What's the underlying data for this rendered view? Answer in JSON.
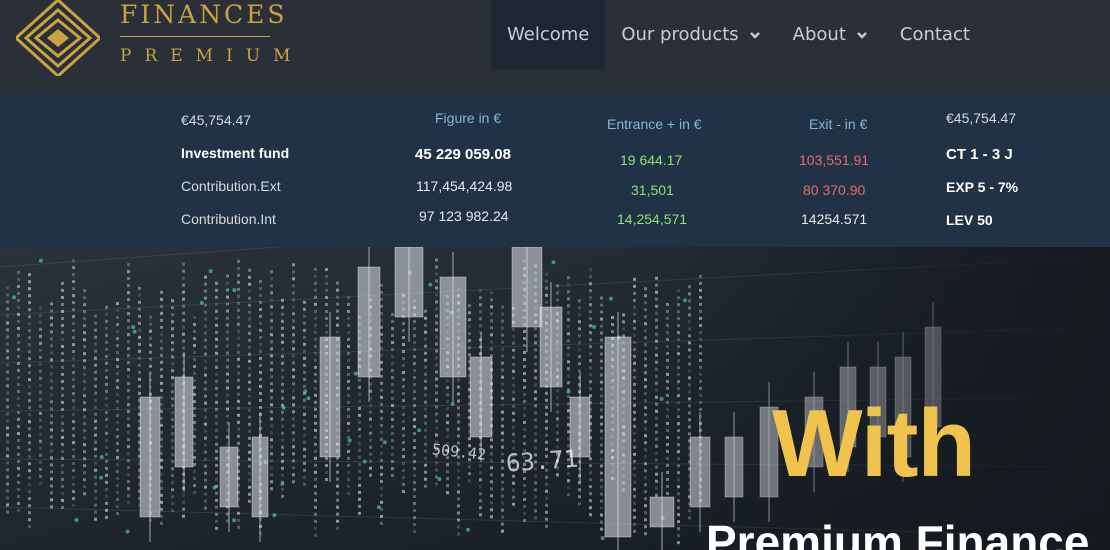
{
  "logo": {
    "word1": "FINANCES",
    "word2": "PREMIUM"
  },
  "nav": {
    "items": [
      {
        "label": "Welcome"
      },
      {
        "label": "Our products"
      },
      {
        "label": "About"
      },
      {
        "label": "Contact"
      }
    ]
  },
  "ticker": {
    "col1": {
      "top": "€45,754.47",
      "rows": [
        "Investment fund",
        "Contribution.Ext",
        "Contribution.Int"
      ]
    },
    "col2": {
      "header": "Figure in €",
      "rows": [
        "45 229 059.08",
        "117,454,424.98",
        "97 123 982.24"
      ]
    },
    "col3": {
      "header": "Entrance + in €",
      "rows": [
        "19 644.17",
        "31,501",
        "14,254,571"
      ]
    },
    "col4": {
      "header": "Exit - in €",
      "rows": [
        "103,551.91",
        "80 370.90",
        "14254.571"
      ]
    },
    "col5": {
      "top": "€45,754.47",
      "rows": [
        "CT 1 - 3 J",
        "EXP 5 - 7%",
        "LEV 50"
      ]
    }
  },
  "hero": {
    "headline": "With",
    "subheadline": "Premium Finance",
    "chart_numbers": [
      "509.42",
      "63.71"
    ]
  },
  "colors": {
    "gold": "#f0c24e",
    "green": "#8fe07a",
    "red": "#e56a6a",
    "header_bg": "#2b3038",
    "ticker_bg": "#213247"
  }
}
